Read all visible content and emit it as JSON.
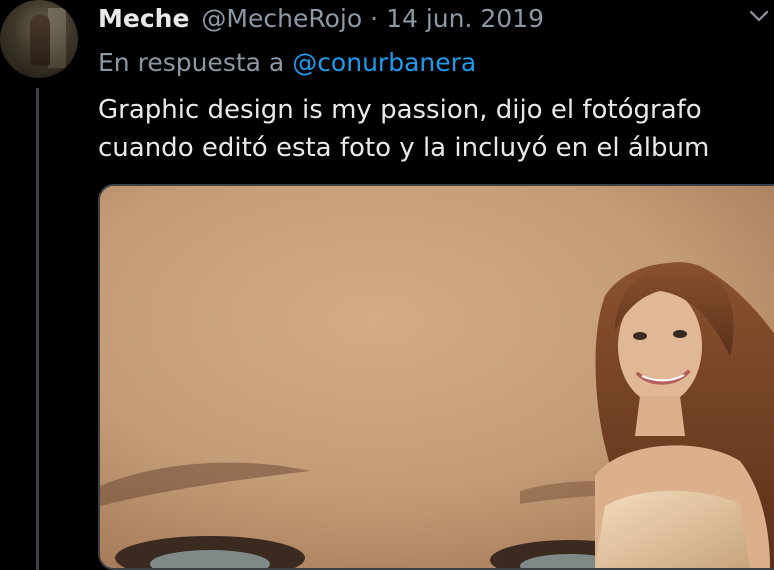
{
  "tweet": {
    "author_name": "Meche",
    "author_handle": "@MecheRojo",
    "separator": "·",
    "date": "14 jun. 2019",
    "reply_prefix": "En respuesta a",
    "reply_to": "@conurbanera",
    "text": "Graphic design is my passion, dijo el fotógrafo cuando editó esta foto y la incluyó en el álbum",
    "menu_icon": "chevron-down-icon"
  },
  "colors": {
    "background": "#000000",
    "link": "#1d9bf0",
    "secondary_text": "#8b98a5",
    "primary_text": "#e7e9ea"
  }
}
